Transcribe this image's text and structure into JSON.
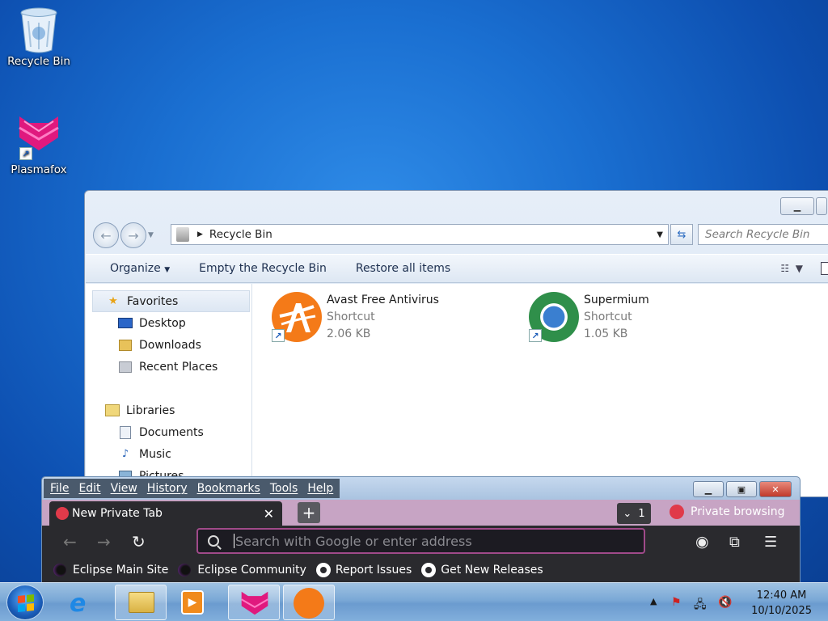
{
  "desktop": {
    "icons": [
      {
        "label": "Recycle Bin",
        "icon": "recycle-bin-icon"
      },
      {
        "label": "Plasmafox",
        "icon": "plasmafox-icon"
      }
    ]
  },
  "explorer": {
    "address": "Recycle Bin",
    "search_placeholder": "Search Recycle Bin",
    "commands": [
      "Organize",
      "Empty the Recycle Bin",
      "Restore all items"
    ],
    "nav": {
      "favorites": "Favorites",
      "desktop": "Desktop",
      "downloads": "Downloads",
      "recent": "Recent Places",
      "libraries": "Libraries",
      "documents": "Documents",
      "music": "Music",
      "pictures": "Pictures"
    },
    "files": [
      {
        "name": "Avast Free Antivirus",
        "type": "Shortcut",
        "size": "2.06 KB"
      },
      {
        "name": "Supermium",
        "type": "Shortcut",
        "size": "1.05 KB"
      }
    ]
  },
  "browser": {
    "menu": [
      "File",
      "Edit",
      "View",
      "History",
      "Bookmarks",
      "Tools",
      "Help"
    ],
    "tab_title": "New Private Tab",
    "tab_count": "1",
    "private_label": "Private browsing",
    "url_placeholder": "Search with Google or enter address",
    "bookmarks": [
      "Eclipse Main Site",
      "Eclipse Community",
      "Report Issues",
      "Get New Releases"
    ],
    "accent": "#a04a8a"
  },
  "taskbar": {
    "time": "12:40 AM",
    "date": "10/10/2025"
  }
}
